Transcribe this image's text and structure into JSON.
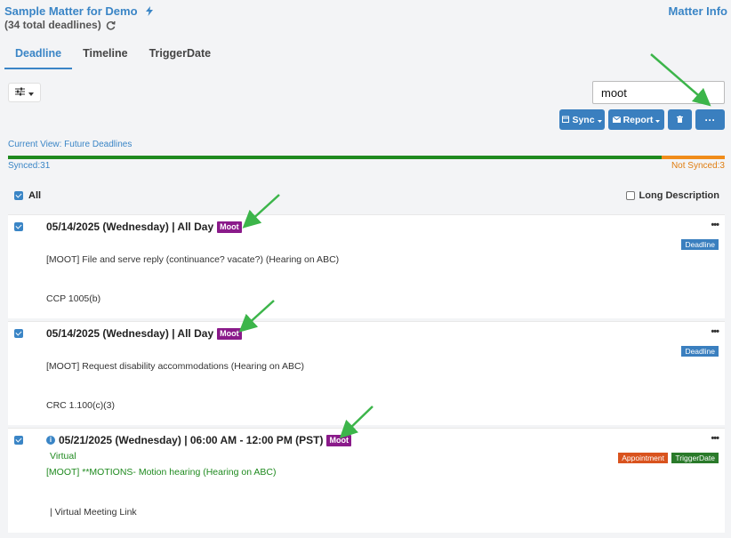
{
  "header": {
    "title": "Sample Matter for Demo",
    "subtitle": "(34 total deadlines)",
    "matter_info": "Matter Info"
  },
  "tabs": [
    {
      "label": "Deadline",
      "active": true
    },
    {
      "label": "Timeline",
      "active": false
    },
    {
      "label": "TriggerDate",
      "active": false
    }
  ],
  "search": {
    "value": "moot"
  },
  "toolbar": {
    "sync_label": "Sync",
    "report_label": "Report",
    "delete_icon": "trash-icon",
    "more_label": "···"
  },
  "status": {
    "current_view": "Current View: Future Deadlines",
    "synced": "Synced:31",
    "not_synced": "Not Synced:3",
    "synced_fraction": 0.912
  },
  "list": {
    "all_label": "All",
    "long_description_label": "Long Description"
  },
  "deadlines": [
    {
      "header": "05/14/2025 (Wednesday) | All Day",
      "badge": "Moot",
      "tag": "Deadline",
      "description": "[MOOT] File and serve reply (continuance? vacate?) (Hearing on ABC)",
      "rule": "CCP 1005(b)"
    },
    {
      "header": "05/14/2025 (Wednesday) | All Day",
      "badge": "Moot",
      "tag": "Deadline",
      "description": "[MOOT] Request disability accommodations (Hearing on ABC)",
      "rule": "CRC 1.100(c)(3)"
    },
    {
      "header": "05/21/2025 (Wednesday) | 06:00 AM - 12:00 PM (PST)",
      "badge": "Moot",
      "tags": [
        "Appointment",
        "TriggerDate"
      ],
      "location": "Virtual",
      "description": "[MOOT] **MOTIONS- Motion hearing (Hearing on ABC)",
      "link": "| Virtual Meeting Link"
    }
  ],
  "colors": {
    "accent": "#3a85c6",
    "moot": "#8a1a8a",
    "synced": "#1f8a1f",
    "not_synced": "#f08c1a",
    "arrow": "#3cb54a"
  }
}
